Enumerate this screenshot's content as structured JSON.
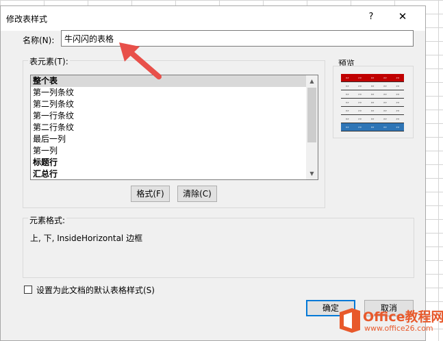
{
  "dialog": {
    "title": "修改表样式",
    "help": "?",
    "close": "✕",
    "name_label": "名称(N):",
    "name_value": "牛闪闪的表格",
    "elements_label": "表元素(T):",
    "elements": [
      {
        "label": "整个表",
        "bold": true,
        "selected": true
      },
      {
        "label": "第一列条纹",
        "bold": false
      },
      {
        "label": "第二列条纹",
        "bold": false
      },
      {
        "label": "第一行条纹",
        "bold": false
      },
      {
        "label": "第二行条纹",
        "bold": false
      },
      {
        "label": "最后一列",
        "bold": false
      },
      {
        "label": "第一列",
        "bold": false
      },
      {
        "label": "标题行",
        "bold": true
      },
      {
        "label": "汇总行",
        "bold": true
      }
    ],
    "format_button": "格式(F)",
    "clear_button": "清除(C)",
    "preview_label": "预览",
    "element_format_label": "元素格式:",
    "element_format_desc": "上, 下, InsideHorizontal 边框",
    "default_checkbox_label": "设置为此文档的默认表格样式(S)",
    "ok_button": "确定",
    "cancel_button": "取消"
  },
  "colors": {
    "preview_header": "#c00000",
    "preview_total": "#2e75b6",
    "arrow": "#e8504a",
    "watermark": "#e8592b"
  },
  "watermark": {
    "brand": "Office教程网",
    "url": "www.office26.com"
  }
}
